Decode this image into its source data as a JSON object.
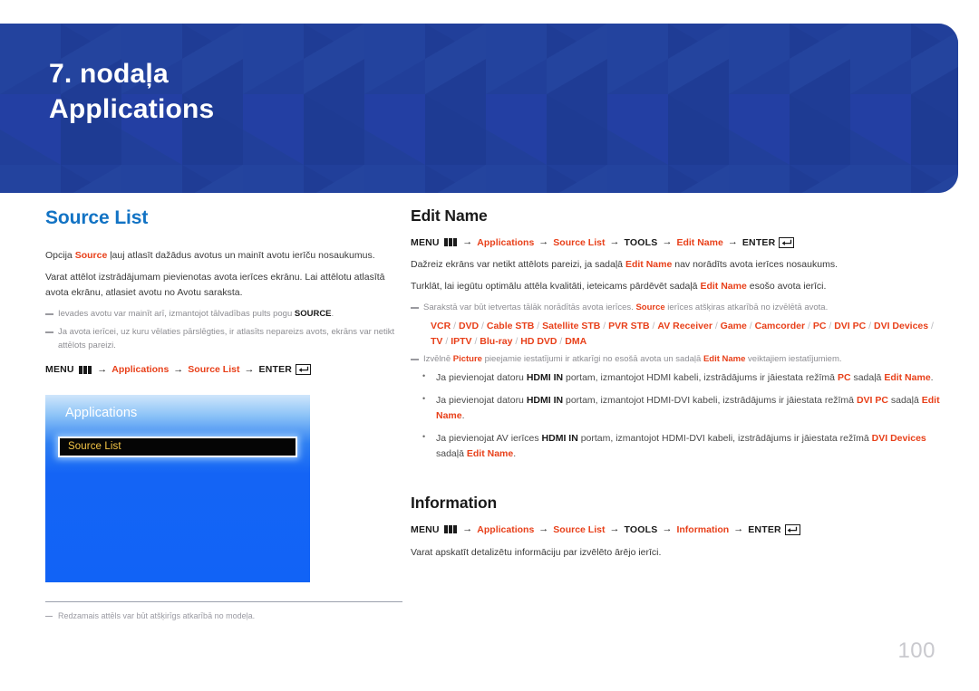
{
  "banner": {
    "chapter_number": "7. nodaļa",
    "chapter_title": "Applications",
    "bg_color": "#21409a"
  },
  "left_column": {
    "heading": "Source List",
    "heading_color": "#1273c4",
    "paragraph1": {
      "pre": "Opcija ",
      "bold_red": "Source",
      "post": " ļauj atlasīt dažādus avotus un mainīt avotu ierīču nosaukumus."
    },
    "paragraph2": "Varat attēlot izstrādājumam pievienotas avota ierīces ekrānu. Lai attēlotu atlasītā avota ekrānu, atlasiet avotu no Avotu saraksta.",
    "note1": {
      "pre": "Ievades avotu var mainīt arī, izmantojot tālvadības pults pogu ",
      "bold": "SOURCE",
      "post": "."
    },
    "note2": "Ja avota ierīcei, uz kuru vēlaties pārslēgties, ir atlasīts nepareizs avots, ekrāns var netikt attēlots pareizi.",
    "menu_path": {
      "menu_label": "MENU",
      "menu_icon": "menu-bars-icon",
      "items": [
        "Applications",
        "Source List"
      ],
      "enter_label": "ENTER",
      "enter_icon": "enter-return-icon",
      "arrow": "→"
    },
    "osd": {
      "title": "Applications",
      "selected_item": "Source List",
      "selected_text_color": "#f6c747",
      "panel_color": "#1163f6"
    },
    "footnote": "Redzamais attēls var būt atšķirīgs atkarībā no modeļa."
  },
  "right_column": {
    "section_edit_name": {
      "heading": "Edit Name",
      "menu_path": {
        "menu_label": "MENU",
        "menu_icon": "menu-bars-icon",
        "items": [
          "Applications",
          "Source List"
        ],
        "tools_label": "TOOLS",
        "item_after_tools": "Edit Name",
        "enter_label": "ENTER",
        "enter_icon": "enter-return-icon",
        "arrow": "→"
      },
      "paragraph1": {
        "pre": "Dažreiz ekrāns var netikt attēlots pareizi, ja sadaļā ",
        "bold_red": "Edit Name",
        "post": " nav norādīts avota ierīces nosaukums."
      },
      "paragraph2": {
        "pre": "Turklāt, lai iegūtu optimālu attēla kvalitāti, ieteicams pārdēvēt sadaļā ",
        "bold_red": "Edit Name",
        "post": " esošo avota ierīci."
      },
      "note_sources": {
        "pre": "Sarakstā var būt ietvertas tālāk norādītās avota ierīces. ",
        "bold_red": "Source",
        "post": " ierīces atšķiras atkarībā no izvēlētā avota."
      },
      "device_list": [
        "VCR",
        "DVD",
        "Cable STB",
        "Satellite STB",
        "PVR STB",
        "AV Receiver",
        "Game",
        "Camcorder",
        "PC",
        "DVI PC",
        "DVI Devices",
        "TV",
        "IPTV",
        "Blu-ray",
        "HD DVD",
        "DMA"
      ],
      "device_separator": "/",
      "note_picture": {
        "pre": "Izvēlnē ",
        "bold_red1": "Picture",
        "mid": " pieejamie iestatījumi ir atkarīgi no esošā avota un sadaļā ",
        "bold_red2": "Edit Name",
        "post": " veiktajiem iestatījumiem."
      },
      "bullets": [
        {
          "seg1": "Ja pievienojat datoru ",
          "bold1": "HDMI IN",
          "seg2": " portam, izmantojot HDMI kabeli, izstrādājums ir jāiestata režīmā ",
          "red1": "PC",
          "seg3": " sadaļā ",
          "red2": "Edit Name",
          "seg4": "."
        },
        {
          "seg1": "Ja pievienojat datoru ",
          "bold1": "HDMI IN",
          "seg2": "  portam, izmantojot HDMI-DVI kabeli, izstrādājums ir jāiestata režīmā ",
          "red1": "DVI PC",
          "seg3": " sadaļā ",
          "red2": "Edit Name",
          "seg4": "."
        },
        {
          "seg1": "Ja pievienojat AV ierīces ",
          "bold1": "HDMI IN",
          "seg2": " portam, izmantojot HDMI-DVI kabeli, izstrādājums ir jāiestata režīmā ",
          "red1": "DVI Devices",
          "seg3": " sadaļā ",
          "red2": "Edit Name",
          "seg4": "."
        }
      ]
    },
    "section_information": {
      "heading": "Information",
      "menu_path": {
        "menu_label": "MENU",
        "menu_icon": "menu-bars-icon",
        "items": [
          "Applications",
          "Source List"
        ],
        "tools_label": "TOOLS",
        "item_after_tools": "Information",
        "enter_label": "ENTER",
        "enter_icon": "enter-return-icon",
        "arrow": "→"
      },
      "paragraph1": "Varat apskatīt detalizētu informāciju par izvēlēto ārējo ierīci."
    }
  },
  "footer": {
    "page_number": "100"
  },
  "colors": {
    "accent_red": "#e8401a",
    "heading_blue": "#1273c4",
    "banner_blue": "#21409a",
    "osd_blue": "#1163f6",
    "osd_highlight_text": "#f6c747",
    "page_number_gray": "#c9c9ce"
  }
}
